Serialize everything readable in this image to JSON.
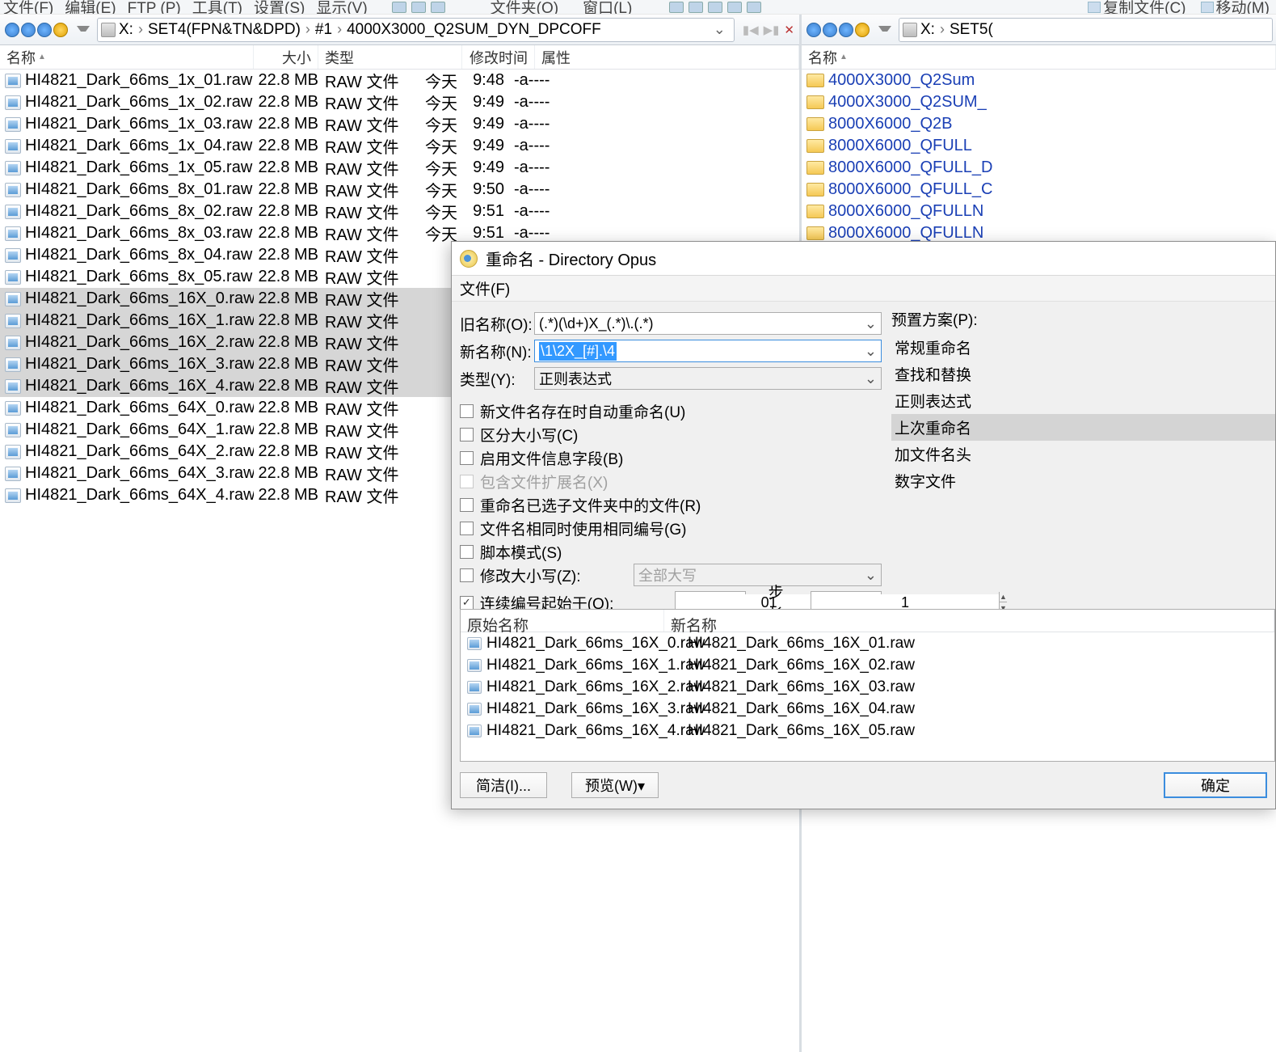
{
  "menubar": {
    "items": [
      "文件(F)",
      "编辑(E)",
      "FTP (P)",
      "工具(T)",
      "设置(S)",
      "显示(V)"
    ],
    "rightItems": [
      "文件夹(O)",
      "窗口(L)"
    ],
    "toolbar": [
      "复制文件(C)",
      "移动(M)"
    ]
  },
  "leftPane": {
    "crumbs": [
      "X:",
      "SET4(FPN&TN&DPD)",
      "#1",
      "4000X3000_Q2SUM_DYN_DPCOFF"
    ],
    "headers": {
      "name": "名称",
      "size": "大小",
      "type": "类型",
      "modified": "修改时间",
      "attr": "属性"
    },
    "files": [
      {
        "name": "HI4821_Dark_66ms_1x_01.raw",
        "size": "22.8 MB",
        "type": "RAW 文件",
        "date": "今天",
        "time": "9:48",
        "attr": "-a----",
        "sel": false
      },
      {
        "name": "HI4821_Dark_66ms_1x_02.raw",
        "size": "22.8 MB",
        "type": "RAW 文件",
        "date": "今天",
        "time": "9:49",
        "attr": "-a----",
        "sel": false
      },
      {
        "name": "HI4821_Dark_66ms_1x_03.raw",
        "size": "22.8 MB",
        "type": "RAW 文件",
        "date": "今天",
        "time": "9:49",
        "attr": "-a----",
        "sel": false
      },
      {
        "name": "HI4821_Dark_66ms_1x_04.raw",
        "size": "22.8 MB",
        "type": "RAW 文件",
        "date": "今天",
        "time": "9:49",
        "attr": "-a----",
        "sel": false
      },
      {
        "name": "HI4821_Dark_66ms_1x_05.raw",
        "size": "22.8 MB",
        "type": "RAW 文件",
        "date": "今天",
        "time": "9:49",
        "attr": "-a----",
        "sel": false
      },
      {
        "name": "HI4821_Dark_66ms_8x_01.raw",
        "size": "22.8 MB",
        "type": "RAW 文件",
        "date": "今天",
        "time": "9:50",
        "attr": "-a----",
        "sel": false
      },
      {
        "name": "HI4821_Dark_66ms_8x_02.raw",
        "size": "22.8 MB",
        "type": "RAW 文件",
        "date": "今天",
        "time": "9:51",
        "attr": "-a----",
        "sel": false
      },
      {
        "name": "HI4821_Dark_66ms_8x_03.raw",
        "size": "22.8 MB",
        "type": "RAW 文件",
        "date": "今天",
        "time": "9:51",
        "attr": "-a----",
        "sel": false
      },
      {
        "name": "HI4821_Dark_66ms_8x_04.raw",
        "size": "22.8 MB",
        "type": "RAW 文件",
        "date": "",
        "time": "",
        "attr": "",
        "sel": false
      },
      {
        "name": "HI4821_Dark_66ms_8x_05.raw",
        "size": "22.8 MB",
        "type": "RAW 文件",
        "date": "",
        "time": "",
        "attr": "",
        "sel": false
      },
      {
        "name": "HI4821_Dark_66ms_16X_0.raw",
        "size": "22.8 MB",
        "type": "RAW 文件",
        "date": "",
        "time": "",
        "attr": "",
        "sel": true
      },
      {
        "name": "HI4821_Dark_66ms_16X_1.raw",
        "size": "22.8 MB",
        "type": "RAW 文件",
        "date": "",
        "time": "",
        "attr": "",
        "sel": true
      },
      {
        "name": "HI4821_Dark_66ms_16X_2.raw",
        "size": "22.8 MB",
        "type": "RAW 文件",
        "date": "",
        "time": "",
        "attr": "",
        "sel": true
      },
      {
        "name": "HI4821_Dark_66ms_16X_3.raw",
        "size": "22.8 MB",
        "type": "RAW 文件",
        "date": "",
        "time": "",
        "attr": "",
        "sel": true
      },
      {
        "name": "HI4821_Dark_66ms_16X_4.raw",
        "size": "22.8 MB",
        "type": "RAW 文件",
        "date": "",
        "time": "",
        "attr": "",
        "sel": true
      },
      {
        "name": "HI4821_Dark_66ms_64X_0.raw",
        "size": "22.8 MB",
        "type": "RAW 文件",
        "date": "",
        "time": "",
        "attr": "",
        "sel": false
      },
      {
        "name": "HI4821_Dark_66ms_64X_1.raw",
        "size": "22.8 MB",
        "type": "RAW 文件",
        "date": "",
        "time": "",
        "attr": "",
        "sel": false
      },
      {
        "name": "HI4821_Dark_66ms_64X_2.raw",
        "size": "22.8 MB",
        "type": "RAW 文件",
        "date": "",
        "time": "",
        "attr": "",
        "sel": false
      },
      {
        "name": "HI4821_Dark_66ms_64X_3.raw",
        "size": "22.8 MB",
        "type": "RAW 文件",
        "date": "",
        "time": "",
        "attr": "",
        "sel": false
      },
      {
        "name": "HI4821_Dark_66ms_64X_4.raw",
        "size": "22.8 MB",
        "type": "RAW 文件",
        "date": "",
        "time": "",
        "attr": "",
        "sel": false
      }
    ]
  },
  "rightPane": {
    "crumbs": [
      "X:",
      "SET5("
    ],
    "headers": {
      "name": "名称"
    },
    "folders": [
      "4000X3000_Q2Sum",
      "4000X3000_Q2SUM_",
      "8000X6000_Q2B",
      "8000X6000_QFULL",
      "8000X6000_QFULL_D",
      "8000X6000_QFULL_C",
      "8000X6000_QFULLN",
      "8000X6000_QFULLN"
    ]
  },
  "dialog": {
    "title": "重命名 - Directory Opus",
    "menuFile": "文件(F)",
    "oldNameLabel": "旧名称(O):",
    "oldNameValue": "(.*)(\\d+)X_(.*)\\.(.*)",
    "newNameLabel": "新名称(N):",
    "newNameValue": "\\1\\2X_[#].\\4",
    "typeLabel": "类型(Y):",
    "typeValue": "正则表达式",
    "checks": {
      "autoRename": "新文件名存在时自动重命名(U)",
      "caseSensitive": "区分大小写(C)",
      "enableInfo": "启用文件信息字段(B)",
      "includeExt": "包含文件扩展名(X)",
      "renameSub": "重命名已选子文件夹中的文件(R)",
      "sameNumber": "文件名相同时使用相同编号(G)",
      "scriptMode": "脚本模式(S)",
      "changeCase": "修改大小写(Z):",
      "caseValue": "全部大写",
      "sequential": "连续编号起始于(Q):"
    },
    "startNum": "01",
    "stepLabel": "步长:",
    "stepValue": "1",
    "presetHeader": "预置方案(P):",
    "presets": [
      "常规重命名",
      "查找和替换",
      "正则表达式",
      "上次重命名",
      "加文件名头",
      "数字文件"
    ],
    "presetSelIndex": 3,
    "previewHdr": {
      "old": "原始名称",
      "new": "新名称"
    },
    "preview": [
      {
        "old": "HI4821_Dark_66ms_16X_0.raw",
        "new": "HI4821_Dark_66ms_16X_01.raw"
      },
      {
        "old": "HI4821_Dark_66ms_16X_1.raw",
        "new": "HI4821_Dark_66ms_16X_02.raw"
      },
      {
        "old": "HI4821_Dark_66ms_16X_2.raw",
        "new": "HI4821_Dark_66ms_16X_03.raw"
      },
      {
        "old": "HI4821_Dark_66ms_16X_3.raw",
        "new": "HI4821_Dark_66ms_16X_04.raw"
      },
      {
        "old": "HI4821_Dark_66ms_16X_4.raw",
        "new": "HI4821_Dark_66ms_16X_05.raw"
      }
    ],
    "buttons": {
      "simple": "简洁(I)...",
      "preview": "预览(W)▾",
      "ok": "确定"
    }
  }
}
